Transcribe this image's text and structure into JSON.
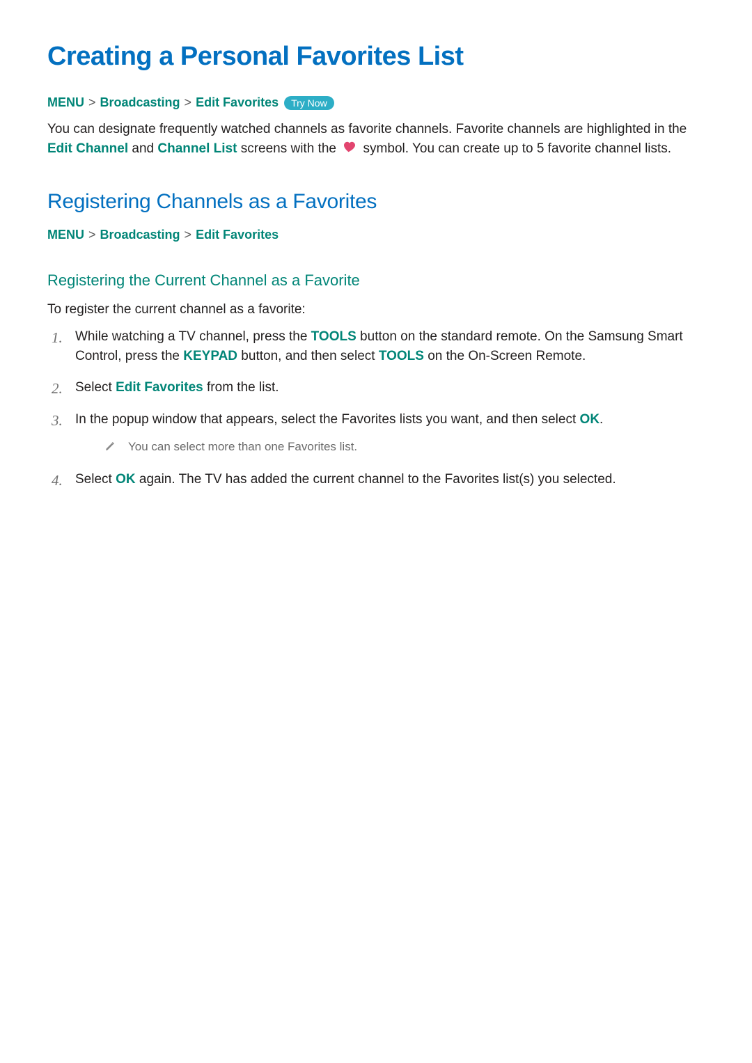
{
  "title": "Creating a Personal Favorites List",
  "breadcrumb1": {
    "menu": "MENU",
    "sep": ">",
    "crumb1": "Broadcasting",
    "crumb2": "Edit Favorites",
    "tryNow": "Try Now"
  },
  "intro": {
    "pre": "You can designate frequently watched channels as favorite channels. Favorite channels are highlighted in the ",
    "editChannel": "Edit Channel",
    "and": " and ",
    "channelList": "Channel List",
    "mid": " screens with the ",
    "post": " symbol. You can create up to 5 favorite channel lists."
  },
  "section2": {
    "title": "Registering Channels as a Favorites",
    "breadcrumb": {
      "menu": "MENU",
      "sep": ">",
      "crumb1": "Broadcasting",
      "crumb2": "Edit Favorites"
    }
  },
  "subsection": {
    "title": "Registering the Current Channel as a Favorite",
    "intro": "To register the current channel as a favorite:",
    "steps": {
      "s1": {
        "pre": "While watching a TV channel, press the ",
        "tools": "TOOLS",
        "mid1": " button on the standard remote. On the Samsung Smart Control, press the ",
        "keypad": "KEYPAD",
        "mid2": " button, and then select ",
        "tools2": "TOOLS",
        "post": " on the On-Screen Remote."
      },
      "s2": {
        "pre": "Select ",
        "editFav": "Edit Favorites",
        "post": " from the list."
      },
      "s3": {
        "pre": "In the popup window that appears, select the Favorites lists you want, and then select ",
        "ok": "OK",
        "post": ".",
        "note": "You can select more than one Favorites list."
      },
      "s4": {
        "pre": "Select ",
        "ok": "OK",
        "post": " again. The TV has added the current channel to the Favorites list(s) you selected."
      }
    }
  }
}
